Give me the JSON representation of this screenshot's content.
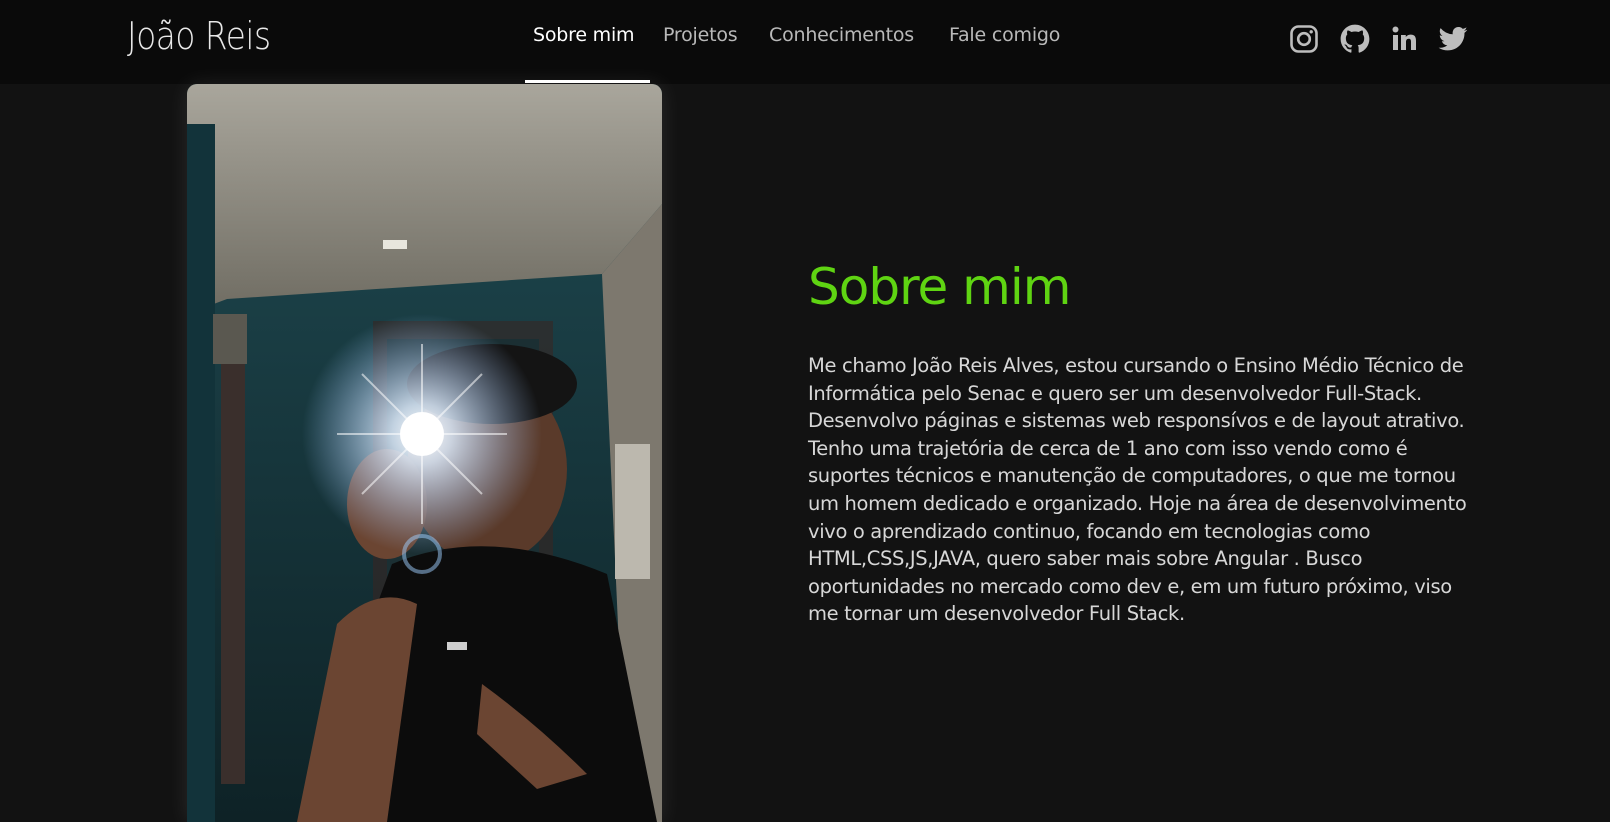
{
  "header": {
    "brand": "João Reis",
    "nav": [
      {
        "label": "Sobre mim",
        "active": true
      },
      {
        "label": "Projetos",
        "active": false
      },
      {
        "label": "Conhecimentos",
        "active": false
      },
      {
        "label": "Fale comigo",
        "active": false
      }
    ],
    "social_icons": [
      "instagram-icon",
      "github-icon",
      "linkedin-icon",
      "twitter-icon"
    ]
  },
  "about": {
    "title": "Sobre mim",
    "text": "Me chamo João Reis Alves, estou cursando o Ensino Médio Técnico de Informática pelo Senac e quero ser um desenvolvedor Full-Stack. Desenvolvo páginas e sistemas web responsívos e de layout atrativo. Tenho uma trajetória de cerca de 1 ano com isso vendo como é suportes técnicos e manutenção de computadores, o que me tornou um homem dedicado e organizado. Hoje na área de desenvolvimento vivo o aprendizado continuo, focando em tecnologias como HTML,CSS,JS,JAVA, quero saber mais sobre Angular . Busco oportunidades no mercado como dev e, em um futuro próximo, viso me tornar um desenvolvedor Full Stack."
  },
  "colors": {
    "background": "#121212",
    "navbar": "#0a0a0a",
    "accent": "#5fd412",
    "nav_text": "#b9b9b9",
    "body_text": "#d7d7d7"
  }
}
